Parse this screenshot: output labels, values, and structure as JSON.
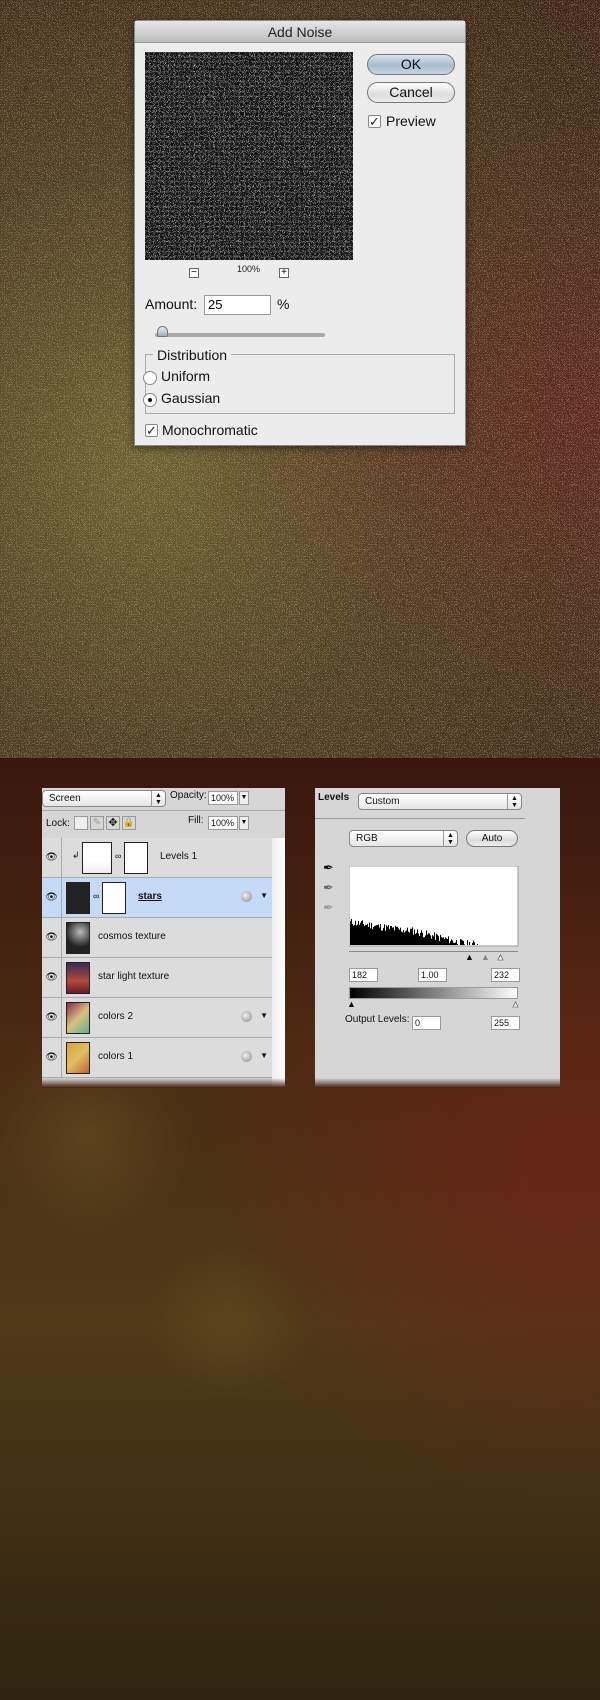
{
  "add_noise": {
    "title": "Add Noise",
    "ok_label": "OK",
    "cancel_label": "Cancel",
    "preview_label": "Preview",
    "preview_checked": true,
    "zoom_level": "100%",
    "zoom_out": "−",
    "zoom_in": "+",
    "amount_label": "Amount:",
    "amount_value": "25",
    "amount_unit": "%",
    "amount_slider_percent": 6,
    "distribution_label": "Distribution",
    "distribution_options": [
      "Uniform",
      "Gaussian"
    ],
    "distribution_selected": "Gaussian",
    "monochromatic_label": "Monochromatic",
    "monochromatic_checked": true
  },
  "layers_panel": {
    "blend_mode": "Screen",
    "opacity_label": "Opacity:",
    "opacity_value": "100%",
    "lock_label": "Lock:",
    "fill_label": "Fill:",
    "fill_value": "100%",
    "layers": [
      {
        "name": "Levels 1",
        "type": "adjustment"
      },
      {
        "name": "stars",
        "active": true
      },
      {
        "name": "cosmos texture"
      },
      {
        "name": "star light texture"
      },
      {
        "name": "colors 2"
      },
      {
        "name": "colors 1"
      }
    ]
  },
  "levels_panel": {
    "title": "Levels",
    "preset": "Custom",
    "channel": "RGB",
    "auto_label": "Auto",
    "input_black": "182",
    "input_gamma": "1.00",
    "input_white": "232",
    "output_label": "Output Levels:",
    "output_black": "0",
    "output_white": "255"
  }
}
